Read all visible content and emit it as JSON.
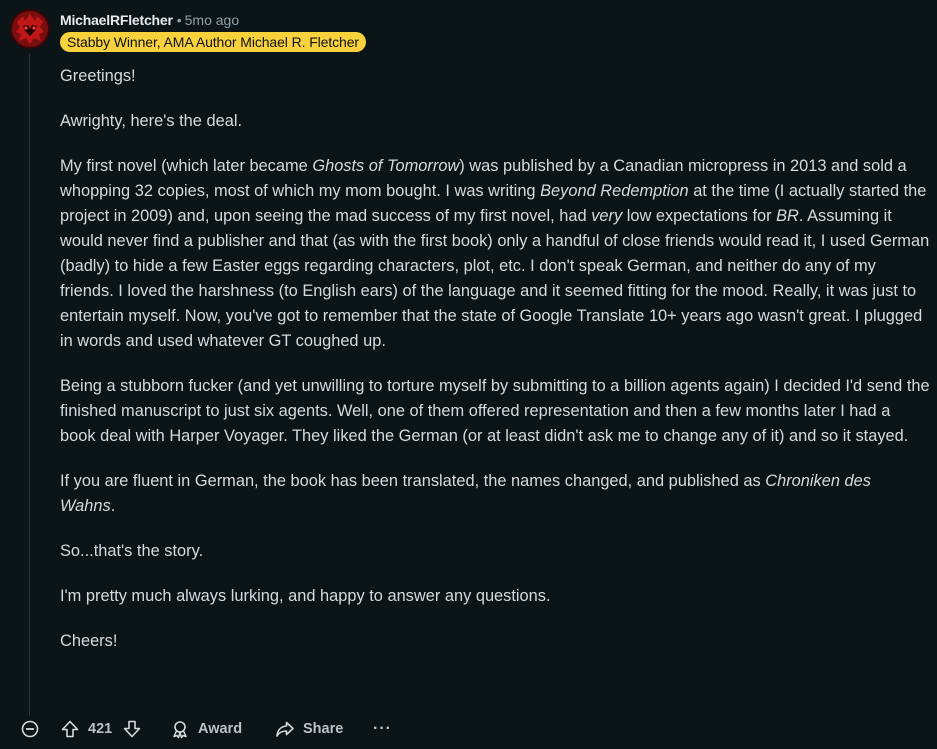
{
  "comment": {
    "author": "MichaelRFletcher",
    "separator": "•",
    "timestamp": "5mo ago",
    "flair": "Stabby Winner, AMA Author Michael R. Fletcher",
    "paragraphs": {
      "p1": "Greetings!",
      "p2": "Awrighty, here's the deal.",
      "p3": {
        "a": "My first novel (which later became ",
        "b": "Ghosts of Tomorrow",
        "c": ") was published by a Canadian micropress in 2013 and sold a whopping 32 copies, most of which my mom bought. I was writing ",
        "d": "Beyond Redemption",
        "e": " at the time (I actually started the project in 2009) and, upon seeing the mad success of my first novel, had ",
        "f": "very",
        "g": " low expectations for ",
        "h": "BR",
        "i": ". Assuming it would never find a publisher and that (as with the first book) only a handful of close friends would read it, I used German (badly) to hide a few Easter eggs regarding characters, plot, etc. I don't speak German, and neither do any of my friends. I loved the harshness (to English ears) of the language and it seemed fitting for the mood. Really, it was just to entertain myself. Now, you've got to remember that the state of Google Translate 10+ years ago wasn't great. I plugged in words and used whatever GT coughed up."
      },
      "p4": "Being a stubborn fucker (and yet unwilling to torture myself by submitting to a billion agents again) I decided I'd send the finished manuscript to just six agents. Well, one of them offered representation and then a few months later I had a book deal with Harper Voyager. They liked the German (or at least didn't ask me to change any of it) and so it stayed.",
      "p5": {
        "a": "If you are fluent in German, the book has been translated, the names changed, and published as ",
        "b": "Chroniken des Wahns",
        "c": "."
      },
      "p6": "So...that's the story.",
      "p7": "I'm pretty much always lurking, and happy to answer any questions.",
      "p8": "Cheers!"
    }
  },
  "actions": {
    "vote_count": "421",
    "award_label": "Award",
    "share_label": "Share",
    "more_label": "···"
  },
  "icons": {
    "avatar": "avatar-icon",
    "collapse": "collapse-minus-icon",
    "upvote": "upvote-arrow-icon",
    "downvote": "downvote-arrow-icon",
    "award": "award-icon",
    "share": "share-icon",
    "more": "more-options-icon"
  },
  "colors": {
    "background": "#0b1416",
    "flair_bg": "#f7d23c",
    "text": "#d7dadc",
    "meta": "#8ba2ad"
  }
}
